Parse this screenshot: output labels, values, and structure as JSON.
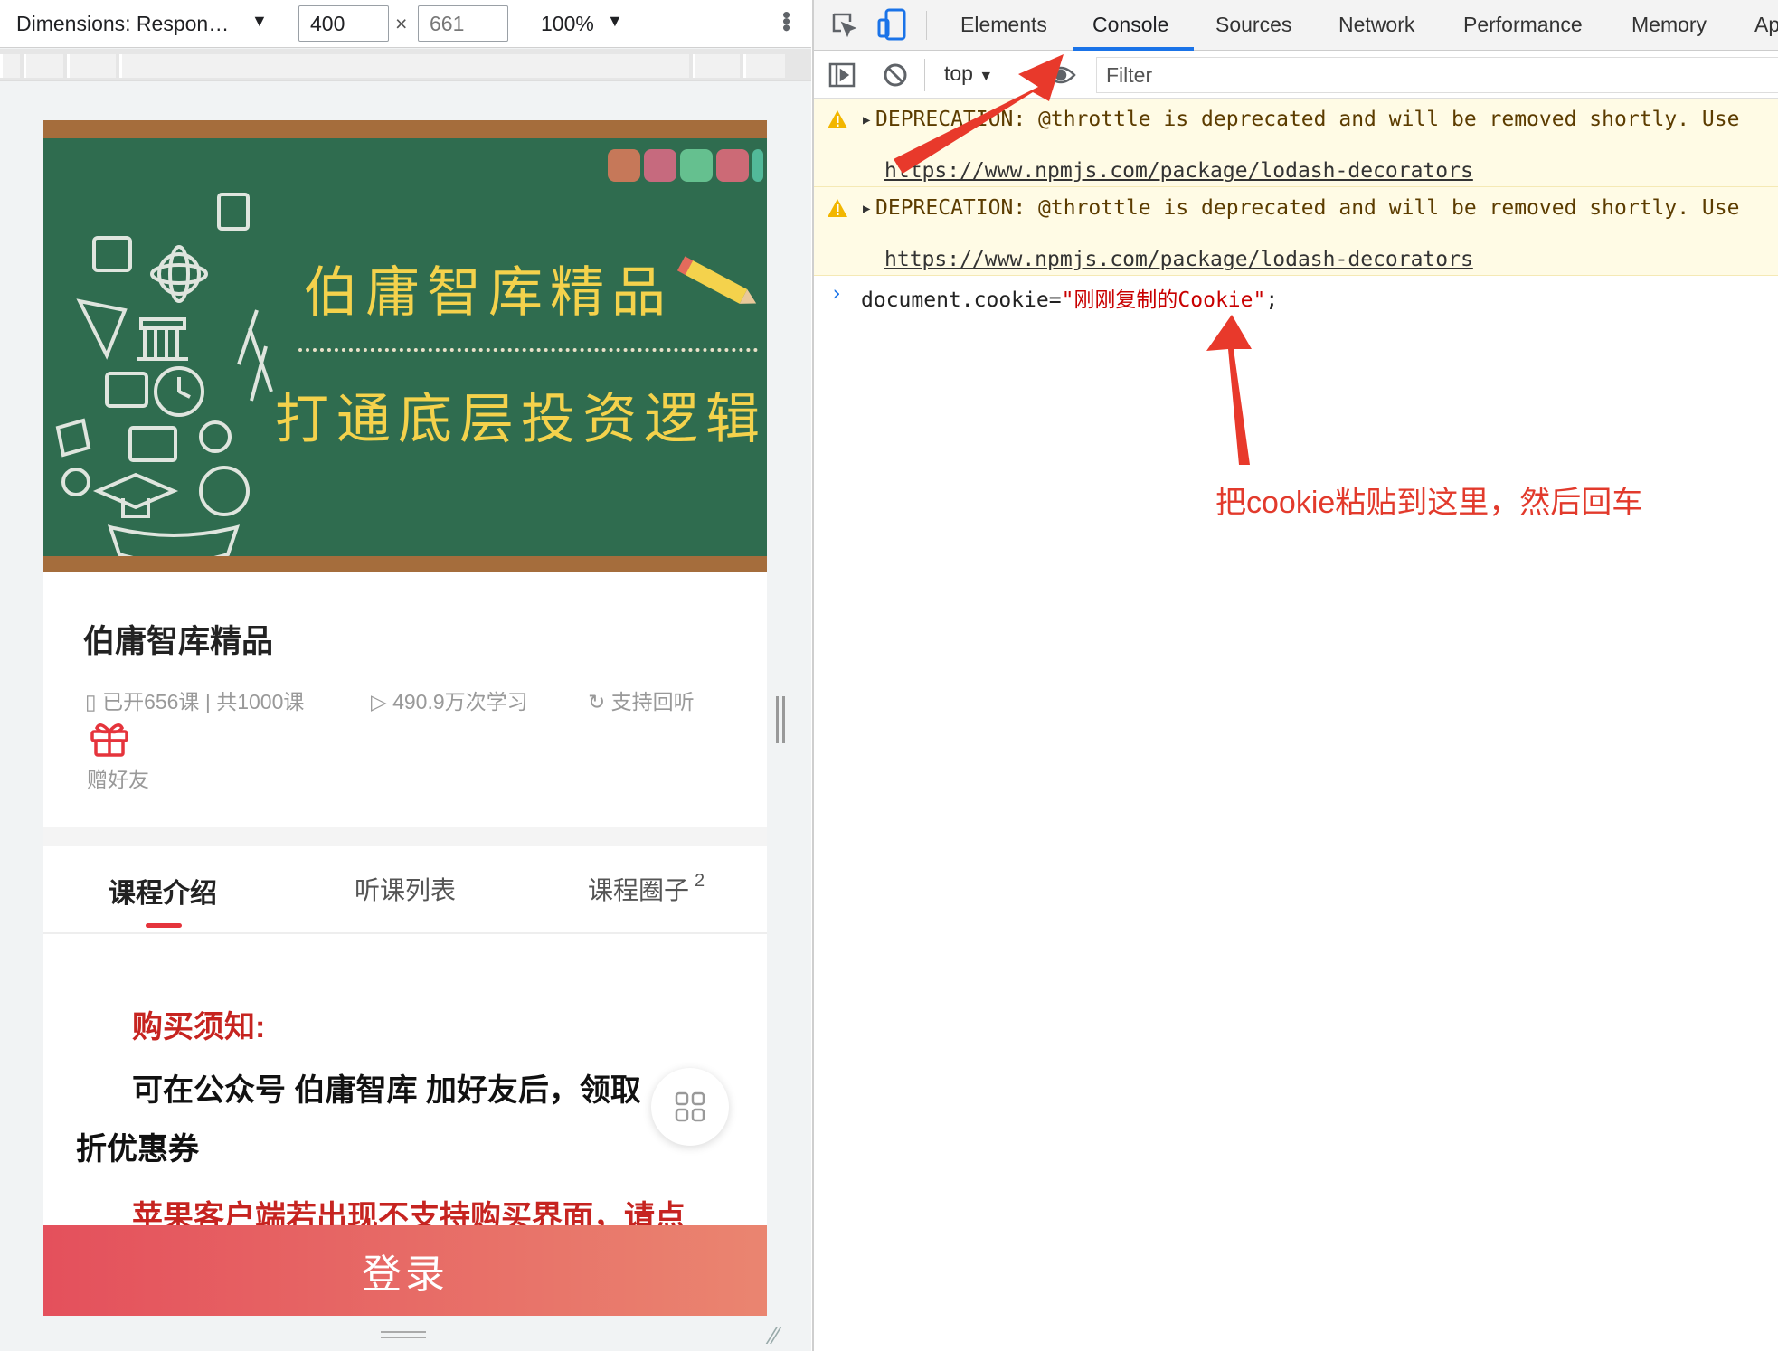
{
  "device_toolbar": {
    "device": "Dimensions: Respon…",
    "width": "400",
    "times": "×",
    "height": "661",
    "zoom": "100%"
  },
  "devtools": {
    "tabs": [
      "Elements",
      "Console",
      "Sources",
      "Network",
      "Performance",
      "Memory",
      "Ap"
    ],
    "active_tab": "Console",
    "context": "top",
    "filter_placeholder": "Filter",
    "messages": [
      {
        "level": "warning",
        "text": "DEPRECATION: @throttle is deprecated and will be removed shortly. Use",
        "link": "https://www.npmjs.com/package/lodash-decorators"
      },
      {
        "level": "warning",
        "text": "DEPRECATION: @throttle is deprecated and will be removed shortly. Use",
        "link": "https://www.npmjs.com/package/lodash-decorators"
      }
    ],
    "command": {
      "prefix": "document.cookie=",
      "string": "\"刚刚复制的Cookie\"",
      "suffix": ";"
    }
  },
  "annotation": "把cookie粘贴到这里，然后回车",
  "page": {
    "banner_line1": "伯庸智库精品",
    "banner_line2": "打通底层投资逻辑",
    "title": "伯庸智库精品",
    "meta_lessons": "已开656课 | 共1000课",
    "meta_views": "490.9万次学习",
    "meta_replay": "支持回听",
    "gift_label": "赠好友",
    "tabs": [
      "课程介绍",
      "听课列表",
      "课程圈子"
    ],
    "tab_badge": "2",
    "content": {
      "notice_title": "购买须知:",
      "line1": "可在公众号 伯庸智库 加好友后，领取",
      "line2": "折优惠券",
      "line3": "苹果客户端若出现不支持购买界面，请点"
    },
    "login_button": "登录"
  },
  "colors": {
    "accent_red": "#e5343c",
    "annotation_red": "#e23a2c",
    "banner_green": "#2f6c4f",
    "banner_text": "#f4d24c",
    "devtools_blue": "#1a73e8",
    "warning_bg": "#fffbe5"
  }
}
